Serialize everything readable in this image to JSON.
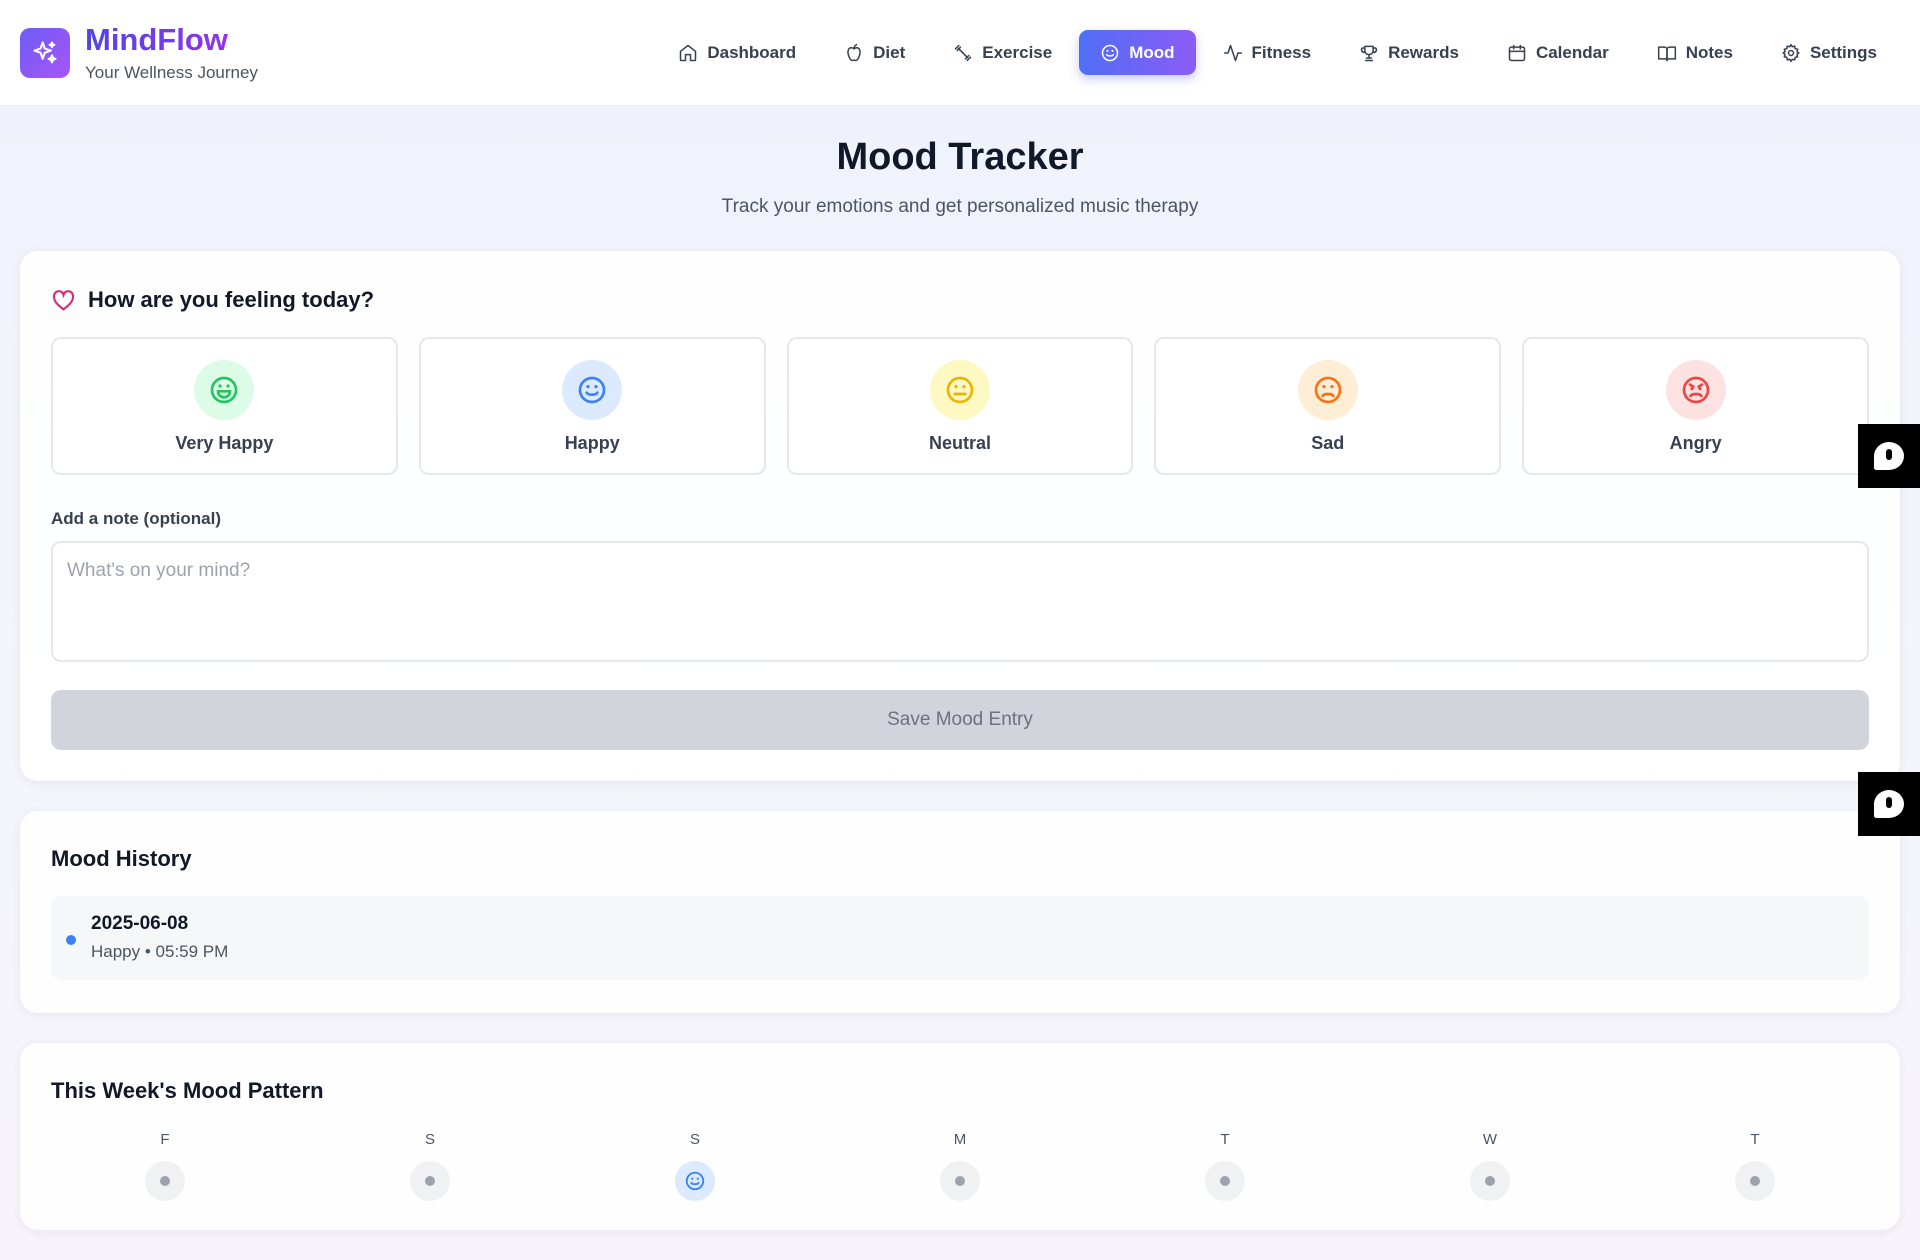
{
  "brand": {
    "name": "MindFlow",
    "tagline": "Your Wellness Journey"
  },
  "nav": [
    {
      "label": "Dashboard",
      "icon": "home-icon",
      "active": false
    },
    {
      "label": "Diet",
      "icon": "apple-icon",
      "active": false
    },
    {
      "label": "Exercise",
      "icon": "dumbbell-icon",
      "active": false
    },
    {
      "label": "Mood",
      "icon": "smile-icon",
      "active": true
    },
    {
      "label": "Fitness",
      "icon": "activity-icon",
      "active": false
    },
    {
      "label": "Rewards",
      "icon": "trophy-icon",
      "active": false
    },
    {
      "label": "Calendar",
      "icon": "calendar-icon",
      "active": false
    },
    {
      "label": "Notes",
      "icon": "book-icon",
      "active": false
    },
    {
      "label": "Settings",
      "icon": "gear-icon",
      "active": false
    }
  ],
  "page": {
    "title": "Mood Tracker",
    "subtitle": "Track your emotions and get personalized music therapy"
  },
  "mood_card": {
    "question": "How are you feeling today?",
    "options": [
      {
        "label": "Very Happy",
        "icon": "laugh-icon",
        "color": "#22c55e",
        "bg": "#dcfce7"
      },
      {
        "label": "Happy",
        "icon": "smile-icon",
        "color": "#3b82f6",
        "bg": "#dbeafe"
      },
      {
        "label": "Neutral",
        "icon": "meh-icon",
        "color": "#eab308",
        "bg": "#fef9c3"
      },
      {
        "label": "Sad",
        "icon": "frown-icon",
        "color": "#f97316",
        "bg": "#ffedd5"
      },
      {
        "label": "Angry",
        "icon": "angry-icon",
        "color": "#ef4444",
        "bg": "#fee2e2"
      }
    ],
    "note_label": "Add a note (optional)",
    "note_placeholder": "What's on your mind?",
    "note_value": "",
    "save_label": "Save Mood Entry"
  },
  "history": {
    "title": "Mood History",
    "entries": [
      {
        "date": "2025-06-08",
        "meta": "Happy • 05:59 PM",
        "dot_color": "#3b82f6"
      }
    ]
  },
  "week": {
    "title": "This Week's Mood Pattern",
    "days": [
      {
        "letter": "F",
        "mood": null
      },
      {
        "letter": "S",
        "mood": null
      },
      {
        "letter": "S",
        "mood": "happy"
      },
      {
        "letter": "M",
        "mood": null
      },
      {
        "letter": "T",
        "mood": null
      },
      {
        "letter": "W",
        "mood": null
      },
      {
        "letter": "T",
        "mood": null
      }
    ]
  }
}
